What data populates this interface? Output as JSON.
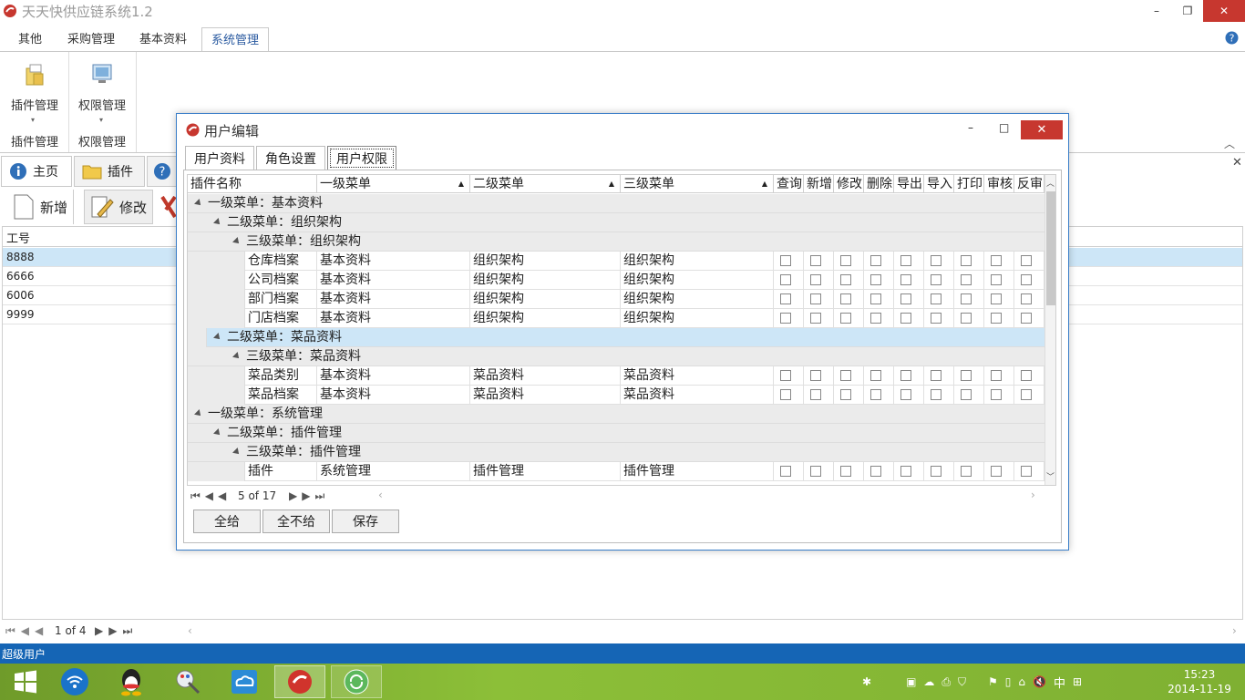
{
  "app": {
    "title": "天天快供应链系统1.2"
  },
  "ribbon": {
    "tabs": [
      "其他",
      "采购管理",
      "基本资料",
      "系统管理"
    ],
    "active_tab": "系统管理",
    "groups": [
      {
        "button": "插件管理",
        "group_label": "插件管理",
        "icon": "plugin-icon"
      },
      {
        "button": "权限管理",
        "group_label": "权限管理",
        "icon": "monitor-icon"
      }
    ]
  },
  "doc_tabs": [
    {
      "label": "主页",
      "icon": "info-icon"
    },
    {
      "label": "插件",
      "icon": "folder-icon"
    },
    {
      "label": "",
      "icon": "help-icon"
    }
  ],
  "toolbar": {
    "new_label": "新增",
    "edit_label": "修改"
  },
  "left_grid": {
    "header": "工号",
    "rows": [
      "8888",
      "6666",
      "6006",
      "9999"
    ],
    "pager": "1 of 4"
  },
  "status": {
    "user": "超级用户"
  },
  "dialog": {
    "title": "用户编辑",
    "tabs": [
      "用户资料",
      "角色设置",
      "用户权限"
    ],
    "active_tab": "用户权限",
    "columns": [
      "插件名称",
      "一级菜单",
      "二级菜单",
      "三级菜单",
      "查询",
      "新增",
      "修改",
      "删除",
      "导出",
      "导入",
      "打印",
      "审核",
      "反审"
    ],
    "groups": {
      "l1_basic": "一级菜单：基本资料",
      "l2_org": "二级菜单：组织架构",
      "l3_org": "三级菜单：组织架构",
      "l2_dish": "二级菜单：菜品资料",
      "l3_dish": "三级菜单：菜品资料",
      "l1_sys": "一级菜单：系统管理",
      "l2_plugin": "二级菜单：插件管理",
      "l3_plugin": "三级菜单：插件管理"
    },
    "rows": [
      {
        "name": "仓库档案",
        "m1": "基本资料",
        "m2": "组织架构",
        "m3": "组织架构"
      },
      {
        "name": "公司档案",
        "m1": "基本资料",
        "m2": "组织架构",
        "m3": "组织架构"
      },
      {
        "name": "部门档案",
        "m1": "基本资料",
        "m2": "组织架构",
        "m3": "组织架构"
      },
      {
        "name": "门店档案",
        "m1": "基本资料",
        "m2": "组织架构",
        "m3": "组织架构"
      },
      {
        "name": "菜品类别",
        "m1": "基本资料",
        "m2": "菜品资料",
        "m3": "菜品资料"
      },
      {
        "name": "菜品档案",
        "m1": "基本资料",
        "m2": "菜品资料",
        "m3": "菜品资料"
      },
      {
        "name": "插件",
        "m1": "系统管理",
        "m2": "插件管理",
        "m3": "插件管理"
      }
    ],
    "pager": "5 of 17",
    "buttons": {
      "give_all": "全给",
      "give_none": "全不给",
      "save": "保存"
    }
  },
  "taskbar": {
    "time": "15:23",
    "date": "2014-11-19",
    "ime": "中"
  },
  "colors": {
    "accent": "#1565b5",
    "close": "#c7372f",
    "selection": "#cde6f7",
    "taskbar": "#8cbf38"
  }
}
